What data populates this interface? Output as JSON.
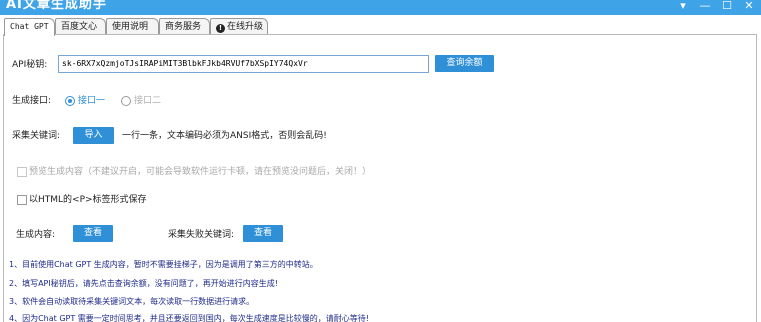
{
  "window": {
    "title": "AI文章生成助手",
    "controls": {
      "menu": "▾",
      "minimize": "—",
      "maximize": "☐",
      "close": "✕"
    }
  },
  "tabs": [
    {
      "label": "Chat GPT",
      "active": true
    },
    {
      "label": "百度文心",
      "active": false
    },
    {
      "label": "使用说明",
      "active": false
    },
    {
      "label": "商务服务",
      "active": false
    },
    {
      "label": "在线升级",
      "active": false
    }
  ],
  "api": {
    "label": "API秘钥:",
    "value": "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",
    "query_button": "查询余额"
  },
  "interface": {
    "label": "生成接口:",
    "options": [
      {
        "label": "接口一",
        "selected": true
      },
      {
        "label": "接口二",
        "selected": false
      }
    ]
  },
  "keywords": {
    "label": "采集关键词:",
    "import_button": "导入",
    "hint": "一行一条，文本编码必须为ANSI格式，否则会乱码!"
  },
  "preview": {
    "label": "预览生成内容（不建议开启，可能会导致软件运行卡顿，请在预览没问题后，关闭！）",
    "checked": false,
    "disabled": true
  },
  "html_option": {
    "label": "以HTML的<P>标签形式保存",
    "checked": false
  },
  "generated": {
    "label": "生成内容:",
    "view_button": "查看"
  },
  "failed": {
    "label": "采集失败关键词:",
    "view_button": "查看"
  },
  "notes": [
    "1、目前使用Chat GPT 生成内容，暂时不需要挂梯子，因为是调用了第三方的中转站。",
    "2、填写API秘钥后，请先点击查询余额，没有问题了，再开始进行内容生成!",
    "3、软件会自动读取待采集关键词文本，每次读取一行数据进行请求。",
    "4、因为Chat GPT 需要一定时间思考，并且还要返回到国内，每次生成速度是比较慢的，请耐心等待!"
  ],
  "colors": {
    "titlebar": "#3fa3e7",
    "button": "#2f90d8",
    "notes_text": "#1e2a8a"
  }
}
